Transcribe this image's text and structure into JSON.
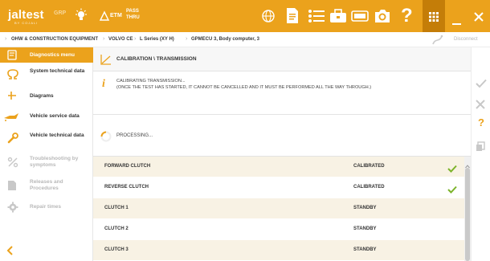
{
  "topbar": {
    "logo": "jaltest",
    "logo_sub": "BY COJALI",
    "grp_label": "GRP",
    "etm_label": "ETM",
    "pass_label": "PASS",
    "thru_label": "THRU",
    "help_glyph": "?",
    "icons": [
      "globe-icon",
      "document-icon",
      "list-icon",
      "toolbox-icon",
      "printer-icon",
      "camera-icon",
      "help-icon",
      "apps-grid-icon",
      "minimize-icon",
      "close-icon"
    ],
    "accent": "#eba21c"
  },
  "breadcrumb": {
    "items": [
      "OHW & CONSTRUCTION EQUIPMENT",
      "VOLVO CE",
      "L Series (XY H)",
      "GPMECU 3, Body computer, 3"
    ],
    "disconnect_label": "Disconnect"
  },
  "sidebar": {
    "items": [
      {
        "label": "Diagnostics menu",
        "icon": "diagnostics-icon",
        "state": "active"
      },
      {
        "label": "System technical data",
        "icon": "ohm-icon",
        "state": "normal"
      },
      {
        "label": "Diagrams",
        "icon": "diagram-icon",
        "state": "normal"
      },
      {
        "label": "Vehicle service data",
        "icon": "oil-can-icon",
        "state": "normal"
      },
      {
        "label": "Vehicle technical data",
        "icon": "wrench-icon",
        "state": "normal"
      },
      {
        "label": "Troubleshooting by symptoms",
        "icon": "percent-icon",
        "state": "disabled"
      },
      {
        "label": "Releases and Procedures",
        "icon": "document-icon",
        "state": "disabled"
      },
      {
        "label": "Repair times",
        "icon": "gear-icon",
        "state": "disabled"
      }
    ]
  },
  "main": {
    "title": "CALIBRATION \\ TRANSMISSION",
    "info_line1": "CALIBRATING TRANSMISSION...",
    "info_line2": "(ONCE THE TEST HAS STARTED, IT CANNOT BE CANCELLED AND IT MUST BE PERFORMED ALL THE WAY THROUGH.)",
    "processing": "PROCESSING...",
    "rows": [
      {
        "name": "FORWARD CLUTCH",
        "status": "CALIBRATED",
        "check": true
      },
      {
        "name": "REVERSE CLUTCH",
        "status": "CALIBRATED",
        "check": true
      },
      {
        "name": "CLUTCH 1",
        "status": "STANDBY",
        "check": false
      },
      {
        "name": "CLUTCH 2",
        "status": "STANDBY",
        "check": false
      },
      {
        "name": "CLUTCH 3",
        "status": "STANDBY",
        "check": false
      }
    ]
  },
  "rail": {
    "help_glyph": "?",
    "icons": [
      "check-icon",
      "cancel-icon",
      "help-icon",
      "copy-icon"
    ]
  }
}
